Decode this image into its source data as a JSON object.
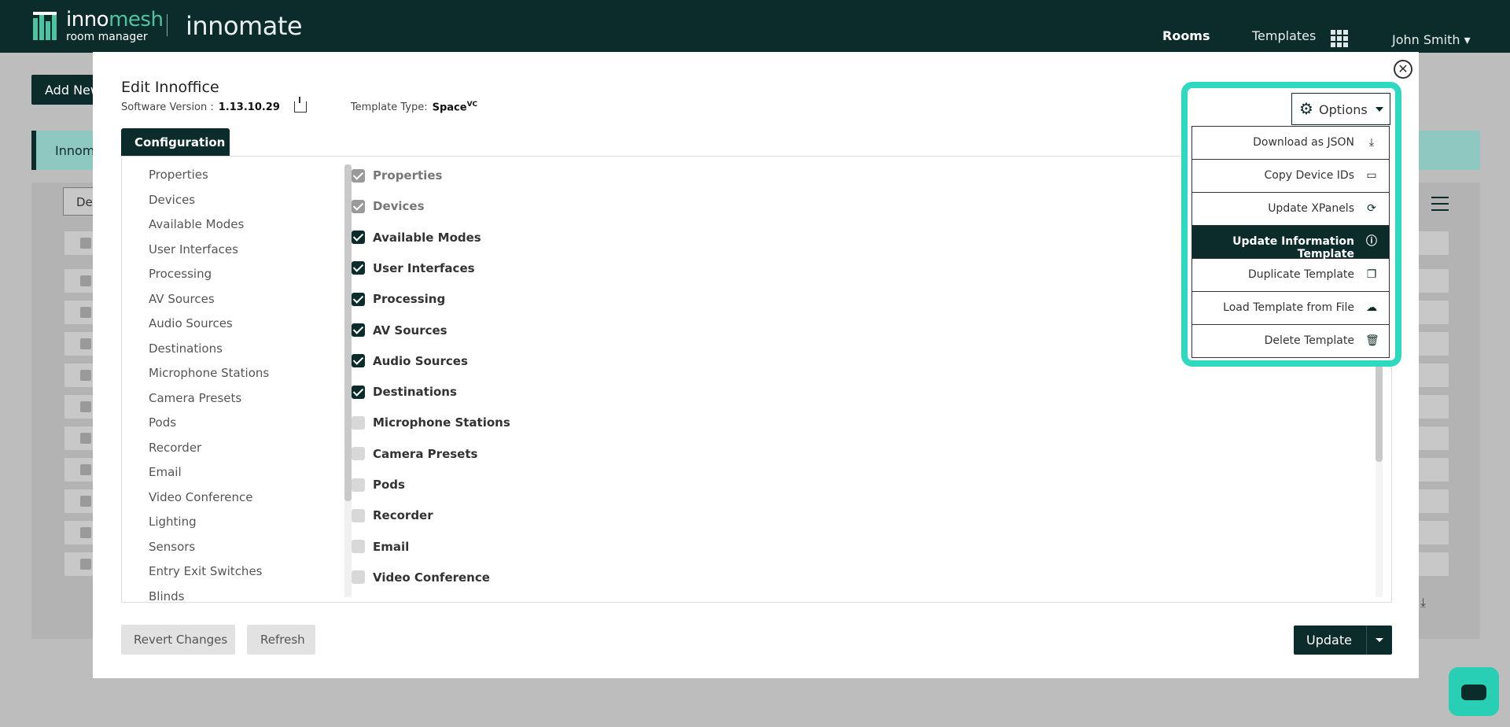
{
  "header": {
    "logo_bold": "inno",
    "logo_accent": "mesh",
    "logo_sub": "room manager",
    "product": "innomate",
    "nav_rooms": "Rooms",
    "nav_templates": "Templates",
    "user": "John Smith ▾"
  },
  "background": {
    "add_button": "Add New",
    "bar_text": "Innome",
    "filter_button": "De"
  },
  "modal": {
    "title": "Edit Innoffice",
    "software_version_label": "Software Version :",
    "software_version": "1.13.10.29",
    "template_type_label": "Template Type:",
    "template_type": "Space",
    "template_type_sup": "VC",
    "tab": "Configuration",
    "sections": [
      "Properties",
      "Devices",
      "Available Modes",
      "User Interfaces",
      "Processing",
      "AV Sources",
      "Audio Sources",
      "Destinations",
      "Microphone Stations",
      "Camera Presets",
      "Pods",
      "Recorder",
      "Email",
      "Video Conference",
      "Lighting",
      "Sensors",
      "Entry Exit Switches",
      "Blinds"
    ],
    "checklist": [
      {
        "label": "Properties",
        "state": "locked"
      },
      {
        "label": "Devices",
        "state": "locked"
      },
      {
        "label": "Available Modes",
        "state": "checked"
      },
      {
        "label": "User Interfaces",
        "state": "checked"
      },
      {
        "label": "Processing",
        "state": "checked"
      },
      {
        "label": "AV Sources",
        "state": "checked"
      },
      {
        "label": "Audio Sources",
        "state": "checked"
      },
      {
        "label": "Destinations",
        "state": "checked"
      },
      {
        "label": "Microphone Stations",
        "state": "unchecked"
      },
      {
        "label": "Camera Presets",
        "state": "unchecked"
      },
      {
        "label": "Pods",
        "state": "unchecked"
      },
      {
        "label": "Recorder",
        "state": "unchecked"
      },
      {
        "label": "Email",
        "state": "unchecked"
      },
      {
        "label": "Video Conference",
        "state": "unchecked"
      }
    ],
    "revert": "Revert Changes",
    "refresh": "Refresh",
    "update": "Update"
  },
  "options": {
    "label": "Options",
    "items": [
      {
        "label": "Download as JSON",
        "icon": "download-icon"
      },
      {
        "label": "Copy Device IDs",
        "icon": "monitor-icon"
      },
      {
        "label": "Update XPanels",
        "icon": "refresh-icon"
      },
      {
        "label": "Update Information Template",
        "icon": "info-icon",
        "active": true
      },
      {
        "label": "Duplicate Template",
        "icon": "copy-icon"
      },
      {
        "label": "Load Template from File",
        "icon": "cloud-upload-icon"
      },
      {
        "label": "Delete Template",
        "icon": "trash-icon"
      }
    ]
  },
  "colors": {
    "brand": "#0c2b2b",
    "accent": "#2ed9c0",
    "logo_accent": "#4fc3a1"
  }
}
